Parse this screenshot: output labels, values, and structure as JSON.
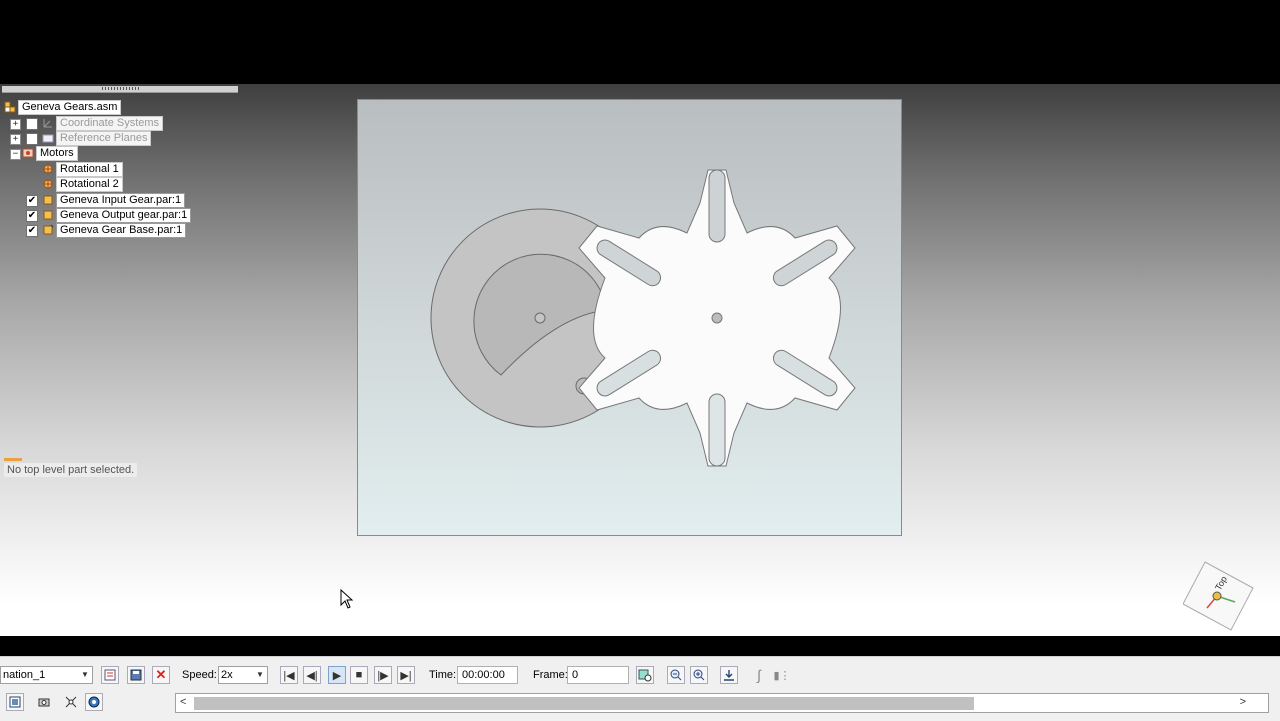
{
  "tree": {
    "root": "Geneva Gears.asm",
    "coordinate_systems": "Coordinate Systems",
    "reference_planes": "Reference Planes",
    "motors": "Motors",
    "rotational_1": "Rotational 1",
    "rotational_2": "Rotational 2",
    "input_gear": "Geneva Input Gear.par:1",
    "output_gear": "Geneva Output gear.par:1",
    "gear_base": "Geneva Gear Base.par:1"
  },
  "status": {
    "message": "No top level part selected."
  },
  "toolbar": {
    "animation_name": "nation_1",
    "speed_label": "Speed:",
    "speed_value": "2x",
    "time_label": "Time:",
    "time_value": "00:00:00",
    "frame_label": "Frame:",
    "frame_value": "0"
  },
  "triad": {
    "label": "Top"
  },
  "colors": {
    "accent": "#e8a040",
    "viewport_top": "#b9bec0",
    "viewport_bottom": "#e2eeef"
  }
}
